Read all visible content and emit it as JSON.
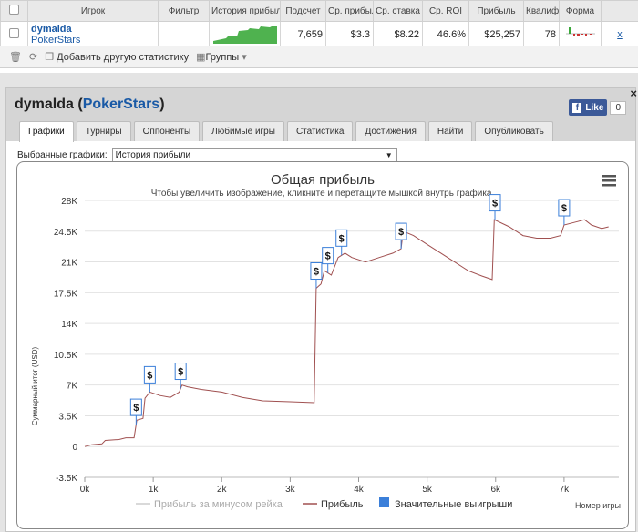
{
  "header": {
    "columns": [
      "Игрок",
      "Фильтр",
      "История прибыли",
      "Подсчет",
      "Ср. прибыль",
      "Ср. ставка",
      "Ср. ROI",
      "Прибыль",
      "Квалиф",
      "Форма"
    ]
  },
  "player_row": {
    "name": "dymalda",
    "network": "PokerStars",
    "count": "7,659",
    "avg_profit": "$3.3",
    "avg_stake": "$8.22",
    "avg_roi": "46.6%",
    "profit": "$25,257",
    "qual": "78",
    "remove": "x"
  },
  "toolbar": {
    "add_stats": "Добавить другую статистику",
    "groups": "Группы"
  },
  "panel": {
    "player": "dymalda",
    "network": "PokerStars",
    "like": "Like",
    "like_count": "0",
    "close": "×",
    "tabs": [
      "Графики",
      "Турниры",
      "Оппоненты",
      "Любимые игры",
      "Статистика",
      "Достижения",
      "Найти",
      "Опубликовать"
    ],
    "select_label": "Выбранные графики:",
    "select_value": "История прибыли"
  },
  "chart_data": {
    "type": "line",
    "title": "Общая прибыль",
    "subtitle": "Чтобы увеличить изображение, кликните и перетащите мышкой внутрь графика.",
    "ylabel": "Суммарный итог (USD)",
    "xlabel": "Номер игры",
    "ylim": [
      -3500,
      28000
    ],
    "xlim": [
      0,
      7800
    ],
    "yticks": [
      "-3.5K",
      "0",
      "3.5K",
      "7K",
      "10.5K",
      "14K",
      "17.5K",
      "21K",
      "24.5K",
      "28K"
    ],
    "xticks": [
      "0k",
      "1k",
      "2k",
      "3k",
      "4k",
      "5k",
      "6k",
      "7k"
    ],
    "legend": [
      "Прибыль за минусом рейка",
      "Прибыль",
      "Значительные выигрыши"
    ],
    "series": [
      {
        "name": "Прибыль",
        "color": "#a05050",
        "points": [
          [
            0,
            0
          ],
          [
            100,
            200
          ],
          [
            250,
            300
          ],
          [
            300,
            700
          ],
          [
            500,
            800
          ],
          [
            600,
            1000
          ],
          [
            720,
            1000
          ],
          [
            760,
            3000
          ],
          [
            850,
            3200
          ],
          [
            880,
            5500
          ],
          [
            950,
            6200
          ],
          [
            1100,
            5800
          ],
          [
            1250,
            5600
          ],
          [
            1380,
            6200
          ],
          [
            1420,
            7000
          ],
          [
            1500,
            6800
          ],
          [
            1700,
            6500
          ],
          [
            2000,
            6200
          ],
          [
            2300,
            5600
          ],
          [
            2600,
            5200
          ],
          [
            3000,
            5100
          ],
          [
            3350,
            5000
          ],
          [
            3380,
            18000
          ],
          [
            3450,
            18500
          ],
          [
            3500,
            20000
          ],
          [
            3600,
            19500
          ],
          [
            3700,
            21500
          ],
          [
            3800,
            22000
          ],
          [
            3900,
            21500
          ],
          [
            4100,
            21000
          ],
          [
            4300,
            21500
          ],
          [
            4500,
            22000
          ],
          [
            4620,
            22500
          ],
          [
            4650,
            24500
          ],
          [
            4800,
            24000
          ],
          [
            5000,
            23000
          ],
          [
            5200,
            22000
          ],
          [
            5400,
            21000
          ],
          [
            5600,
            20000
          ],
          [
            5800,
            19400
          ],
          [
            5950,
            19000
          ],
          [
            5980,
            25800
          ],
          [
            6200,
            25000
          ],
          [
            6400,
            24000
          ],
          [
            6600,
            23700
          ],
          [
            6800,
            23700
          ],
          [
            6950,
            24000
          ],
          [
            7000,
            25200
          ],
          [
            7200,
            25600
          ],
          [
            7300,
            25800
          ],
          [
            7400,
            25200
          ],
          [
            7550,
            24800
          ],
          [
            7650,
            25000
          ]
        ]
      }
    ],
    "big_wins_x": [
      750,
      950,
      1400,
      3380,
      3550,
      3750,
      4620,
      5990,
      7000
    ]
  }
}
